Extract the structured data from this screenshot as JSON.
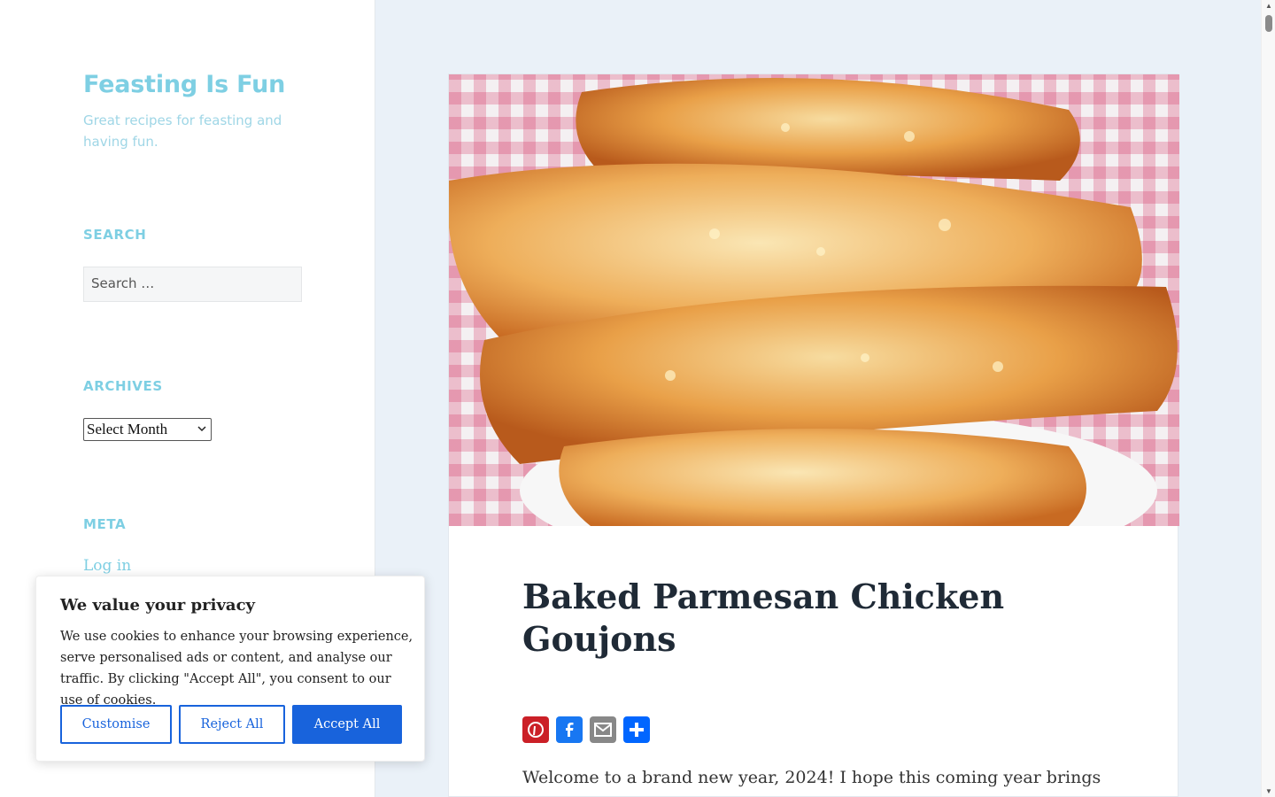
{
  "site": {
    "title": "Feasting Is Fun",
    "description": "Great recipes for feasting and having fun."
  },
  "sidebar": {
    "search_heading": "SEARCH",
    "search_placeholder": "Search …",
    "archives_heading": "ARCHIVES",
    "archives_selected": "Select Month",
    "meta_heading": "META",
    "meta_login": "Log in"
  },
  "post": {
    "title": "Baked Parmesan Chicken Goujons",
    "intro": "Welcome to a brand new year, 2024! I hope this coming year brings",
    "share": [
      {
        "icon": "pinterest-icon",
        "color": "#cb2027"
      },
      {
        "icon": "facebook-icon",
        "color": "#1877f2"
      },
      {
        "icon": "email-icon",
        "color": "#888888"
      },
      {
        "icon": "share-icon",
        "color": "#0166ff"
      }
    ]
  },
  "cookie": {
    "title": "We value your privacy",
    "text": "We use cookies to enhance your browsing experience, serve personalised ads or content, and analyse our traffic. By clicking \"Accept All\", you consent to our use of cookies.",
    "customise": "Customise",
    "reject": "Reject All",
    "accept": "Accept All"
  },
  "colors": {
    "accent": "#7ecfe3",
    "button_blue": "#1863dc",
    "page_bg": "#eaf1f8"
  }
}
